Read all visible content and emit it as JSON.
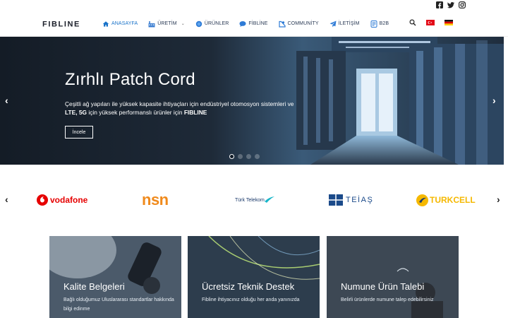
{
  "topbar": {
    "social": [
      "facebook-icon",
      "twitter-icon",
      "instagram-icon"
    ]
  },
  "header": {
    "logo_text": "FIBLINE",
    "nav": [
      {
        "label": "ANASAYFA",
        "icon": "home-icon",
        "active": true
      },
      {
        "label": "ÜRETİM",
        "icon": "factory-icon",
        "dropdown": true
      },
      {
        "label": "ÜRÜNLER",
        "icon": "globe-icon"
      },
      {
        "label": "FİBLİNE",
        "icon": "chat-bubble-icon"
      },
      {
        "label": "COMMUNİTY",
        "icon": "community-icon"
      },
      {
        "label": "İLETİŞİM",
        "icon": "paper-plane-icon"
      },
      {
        "label": "B2B",
        "icon": "b2b-icon"
      }
    ],
    "flags": [
      "turkey-flag",
      "germany-flag"
    ]
  },
  "hero": {
    "title": "Zırhlı Patch Cord",
    "line1": "Çeşitli ağ yapıları ile yüksek kapasite ihtiyaçları için endüstriyel otomosyon sistemleri ve",
    "line2_b1": "LTE, 5G",
    "line2_mid": " için yüksek performanslı ürünler için ",
    "line2_b2": "FIBLINE",
    "button": "İncele",
    "slides": 4,
    "active_slide": 1
  },
  "partners": {
    "logos": [
      {
        "name": "vodafone",
        "text": "vodafone",
        "color": "#e60000"
      },
      {
        "name": "nsn",
        "text": "nsn",
        "color": "#f08a1c"
      },
      {
        "name": "turk-telekom",
        "text": "Türk Telekom",
        "color": "#18b6c9"
      },
      {
        "name": "teias",
        "text": "TEİAŞ",
        "color": "#1b4a8a"
      },
      {
        "name": "turkcell",
        "text": "TURKCELL",
        "color": "#f5b800"
      }
    ]
  },
  "cards": [
    {
      "title": "Kalite Belgeleri",
      "desc": "Bağlı olduğumuz Uluslararası standartlar hakkında bilgi edinme"
    },
    {
      "title": "Ücretsiz Teknik Destek",
      "desc": "Fibline ihtiyacınız olduğu her anda yanınızda"
    },
    {
      "title": "Numune Ürün Talebi",
      "desc": "Belirli ürünlerde numune talep edebilirsiniz"
    }
  ],
  "colors": {
    "accent": "#1a73c9",
    "nav_text": "#2a3a55",
    "hero_bg": "#1c2a3a"
  }
}
